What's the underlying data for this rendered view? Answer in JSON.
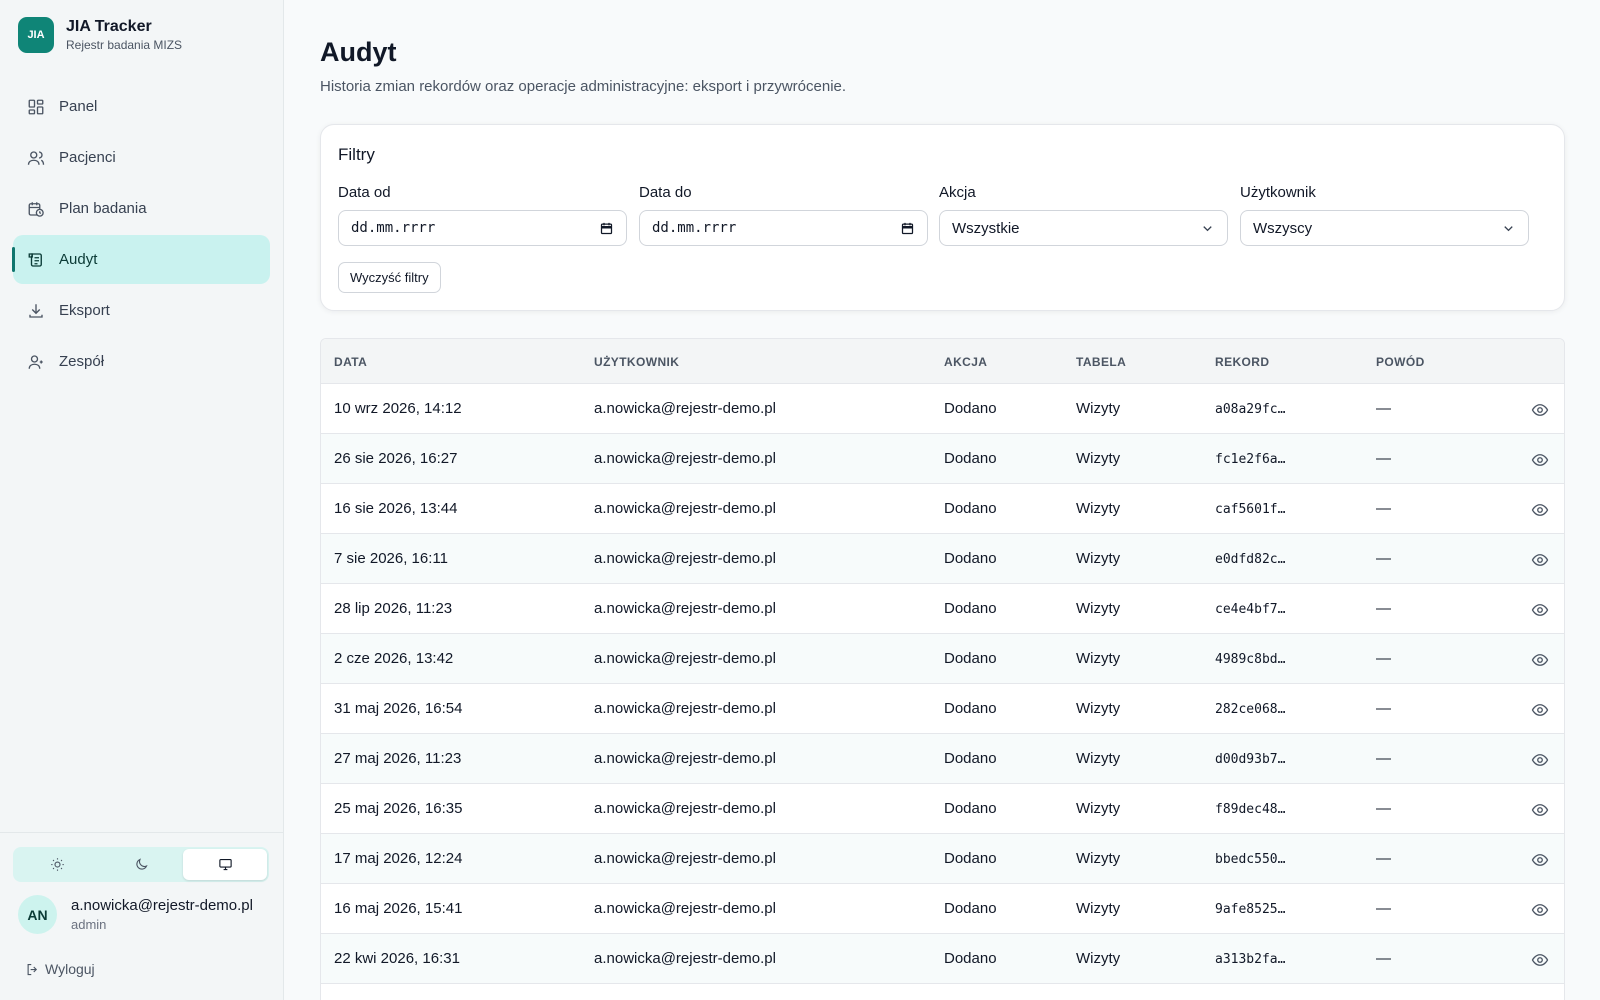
{
  "brand": {
    "logo": "JIA",
    "title": "JIA Tracker",
    "subtitle": "Rejestr badania MIZS"
  },
  "nav": [
    {
      "label": "Panel",
      "icon": "dashboard-grid-icon"
    },
    {
      "label": "Pacjenci",
      "icon": "users-icon"
    },
    {
      "label": "Plan badania",
      "icon": "calendar-clock-icon"
    },
    {
      "label": "Audyt",
      "icon": "scroll-log-icon",
      "active": true
    },
    {
      "label": "Eksport",
      "icon": "download-icon"
    },
    {
      "label": "Zespół",
      "icon": "user-team-icon"
    }
  ],
  "theme": {
    "options": [
      "sun-icon",
      "moon-icon",
      "monitor-icon"
    ],
    "selected": "monitor-icon"
  },
  "user": {
    "initials": "AN",
    "email": "a.nowicka@rejestr-demo.pl",
    "role": "admin"
  },
  "logout": {
    "label": "Wyloguj"
  },
  "page": {
    "title": "Audyt",
    "description": "Historia zmian rekordów oraz operacje administracyjne: eksport i przywrócenie."
  },
  "filters": {
    "title": "Filtry",
    "date_from": {
      "label": "Data od",
      "value": "dd.mm.rrrr"
    },
    "date_to": {
      "label": "Data do",
      "value": "dd.mm.rrrr"
    },
    "action": {
      "label": "Akcja",
      "value": "Wszystkie"
    },
    "user": {
      "label": "Użytkownik",
      "value": "Wszyscy"
    },
    "clear_label": "Wyczyść filtry"
  },
  "table": {
    "headers": {
      "date": "DATA",
      "user": "UŻYTKOWNIK",
      "action": "AKCJA",
      "table": "TABELA",
      "record": "REKORD",
      "reason": "POWÓD"
    },
    "rows": [
      {
        "date": "10 wrz 2026, 14:12",
        "user": "a.nowicka@rejestr-demo.pl",
        "action": "Dodano",
        "table": "Wizyty",
        "record": "a08a29fc…",
        "reason": "—"
      },
      {
        "date": "26 sie 2026, 16:27",
        "user": "a.nowicka@rejestr-demo.pl",
        "action": "Dodano",
        "table": "Wizyty",
        "record": "fc1e2f6a…",
        "reason": "—"
      },
      {
        "date": "16 sie 2026, 13:44",
        "user": "a.nowicka@rejestr-demo.pl",
        "action": "Dodano",
        "table": "Wizyty",
        "record": "caf5601f…",
        "reason": "—"
      },
      {
        "date": "7 sie 2026, 16:11",
        "user": "a.nowicka@rejestr-demo.pl",
        "action": "Dodano",
        "table": "Wizyty",
        "record": "e0dfd82c…",
        "reason": "—"
      },
      {
        "date": "28 lip 2026, 11:23",
        "user": "a.nowicka@rejestr-demo.pl",
        "action": "Dodano",
        "table": "Wizyty",
        "record": "ce4e4bf7…",
        "reason": "—"
      },
      {
        "date": "2 cze 2026, 13:42",
        "user": "a.nowicka@rejestr-demo.pl",
        "action": "Dodano",
        "table": "Wizyty",
        "record": "4989c8bd…",
        "reason": "—"
      },
      {
        "date": "31 maj 2026, 16:54",
        "user": "a.nowicka@rejestr-demo.pl",
        "action": "Dodano",
        "table": "Wizyty",
        "record": "282ce068…",
        "reason": "—"
      },
      {
        "date": "27 maj 2026, 11:23",
        "user": "a.nowicka@rejestr-demo.pl",
        "action": "Dodano",
        "table": "Wizyty",
        "record": "d00d93b7…",
        "reason": "—"
      },
      {
        "date": "25 maj 2026, 16:35",
        "user": "a.nowicka@rejestr-demo.pl",
        "action": "Dodano",
        "table": "Wizyty",
        "record": "f89dec48…",
        "reason": "—"
      },
      {
        "date": "17 maj 2026, 12:24",
        "user": "a.nowicka@rejestr-demo.pl",
        "action": "Dodano",
        "table": "Wizyty",
        "record": "bbedc550…",
        "reason": "—"
      },
      {
        "date": "16 maj 2026, 15:41",
        "user": "a.nowicka@rejestr-demo.pl",
        "action": "Dodano",
        "table": "Wizyty",
        "record": "9afe8525…",
        "reason": "—"
      },
      {
        "date": "22 kwi 2026, 16:31",
        "user": "a.nowicka@rejestr-demo.pl",
        "action": "Dodano",
        "table": "Wizyty",
        "record": "a313b2fa…",
        "reason": "—"
      }
    ]
  },
  "colors": {
    "accent": "#0f8577",
    "active_nav_bg": "#c9f2ef",
    "sidebar_bg": "#f3f6f7",
    "page_bg": "#f8fafb"
  }
}
